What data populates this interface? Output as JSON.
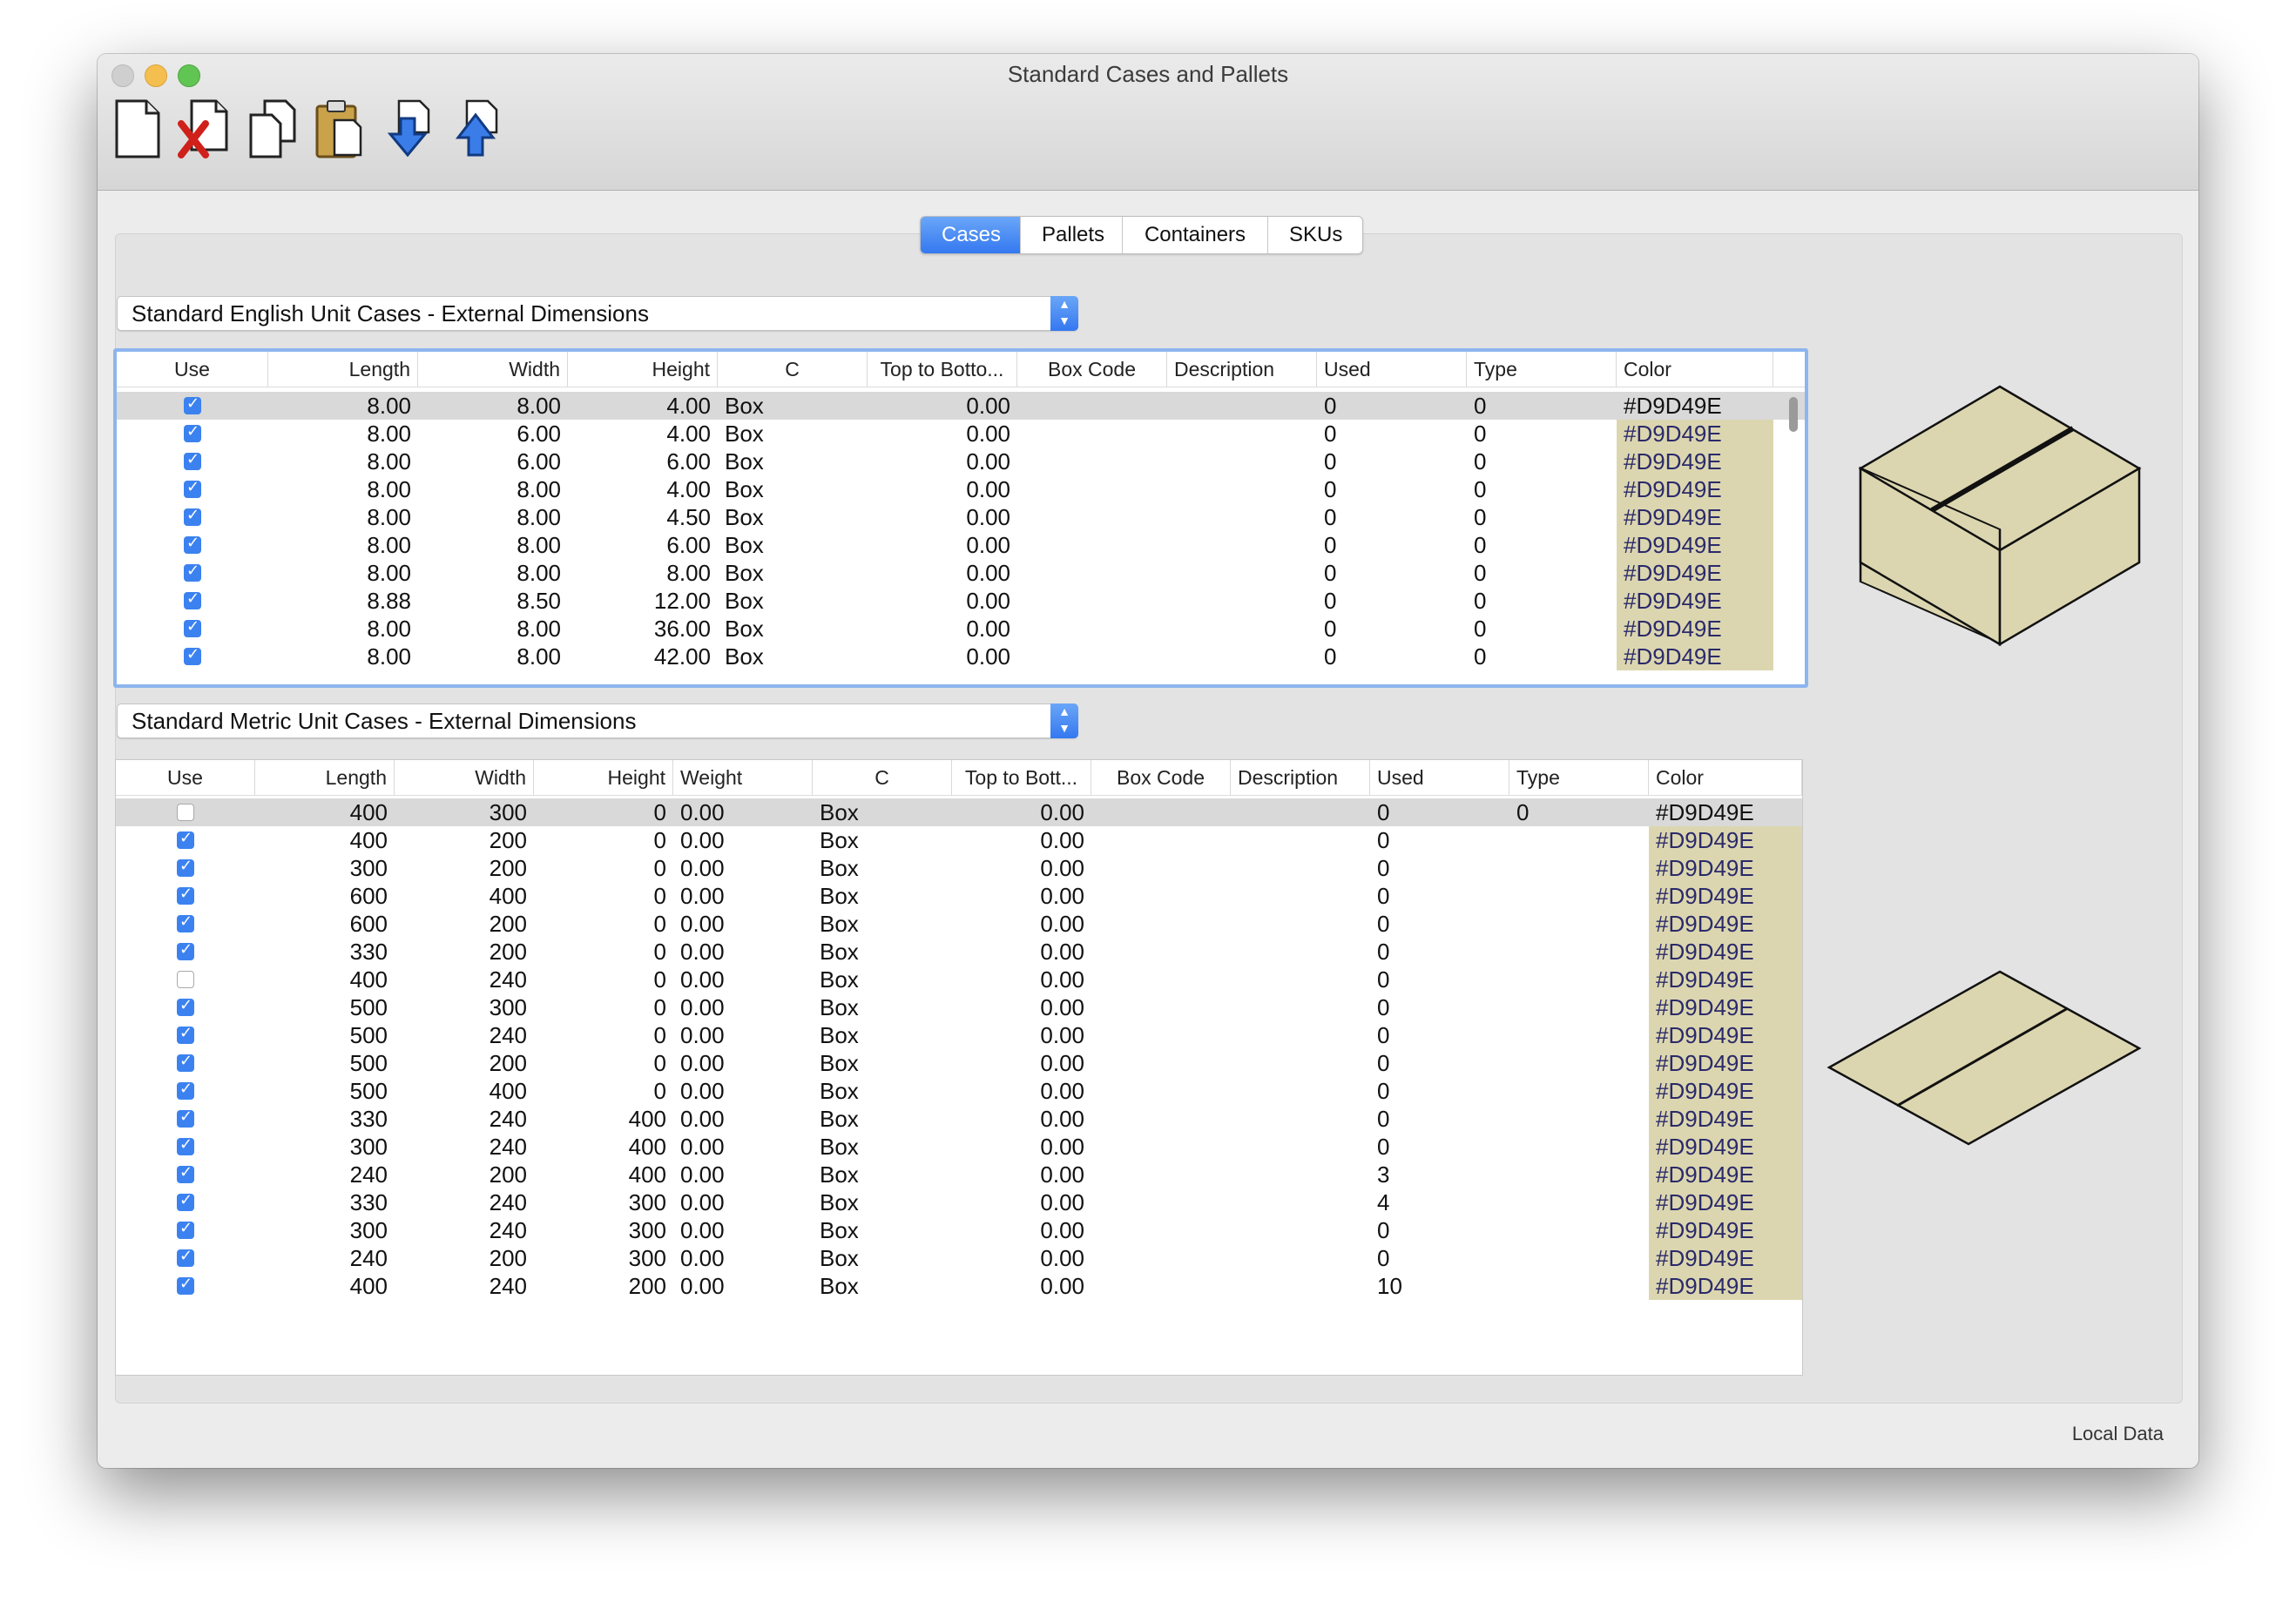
{
  "window": {
    "title": "Standard Cases and Pallets",
    "footer_label": "Local Data"
  },
  "toolbar": {
    "buttons": [
      {
        "name": "new-document",
        "icon": "new-document-icon"
      },
      {
        "name": "delete-document",
        "icon": "delete-document-icon"
      },
      {
        "name": "copy",
        "icon": "copy-icon"
      },
      {
        "name": "paste",
        "icon": "clipboard-icon"
      },
      {
        "name": "import",
        "icon": "download-arrow-icon"
      },
      {
        "name": "export",
        "icon": "upload-arrow-icon"
      }
    ]
  },
  "tabs": [
    "Cases",
    "Pallets",
    "Containers",
    "SKUs"
  ],
  "active_tab": "Cases",
  "english": {
    "select_value": "Standard English Unit Cases - External Dimensions",
    "headers": [
      "Use",
      "Length",
      "Width",
      "Height",
      "C",
      "Top to Botto...",
      "Box Code",
      "Description",
      "Used",
      "Type",
      "Color"
    ],
    "rows": [
      {
        "use": true,
        "length": "8.00",
        "width": "8.00",
        "height": "4.00",
        "c": "Box",
        "top": "0.00",
        "used": "0",
        "type": "0",
        "color": "#D9D49E"
      },
      {
        "use": true,
        "length": "8.00",
        "width": "6.00",
        "height": "4.00",
        "c": "Box",
        "top": "0.00",
        "used": "0",
        "type": "0",
        "color": "#D9D49E"
      },
      {
        "use": true,
        "length": "8.00",
        "width": "6.00",
        "height": "6.00",
        "c": "Box",
        "top": "0.00",
        "used": "0",
        "type": "0",
        "color": "#D9D49E"
      },
      {
        "use": true,
        "length": "8.00",
        "width": "8.00",
        "height": "4.00",
        "c": "Box",
        "top": "0.00",
        "used": "0",
        "type": "0",
        "color": "#D9D49E"
      },
      {
        "use": true,
        "length": "8.00",
        "width": "8.00",
        "height": "4.50",
        "c": "Box",
        "top": "0.00",
        "used": "0",
        "type": "0",
        "color": "#D9D49E"
      },
      {
        "use": true,
        "length": "8.00",
        "width": "8.00",
        "height": "6.00",
        "c": "Box",
        "top": "0.00",
        "used": "0",
        "type": "0",
        "color": "#D9D49E"
      },
      {
        "use": true,
        "length": "8.00",
        "width": "8.00",
        "height": "8.00",
        "c": "Box",
        "top": "0.00",
        "used": "0",
        "type": "0",
        "color": "#D9D49E"
      },
      {
        "use": true,
        "length": "8.88",
        "width": "8.50",
        "height": "12.00",
        "c": "Box",
        "top": "0.00",
        "used": "0",
        "type": "0",
        "color": "#D9D49E"
      },
      {
        "use": true,
        "length": "8.00",
        "width": "8.00",
        "height": "36.00",
        "c": "Box",
        "top": "0.00",
        "used": "0",
        "type": "0",
        "color": "#D9D49E"
      },
      {
        "use": true,
        "length": "8.00",
        "width": "8.00",
        "height": "42.00",
        "c": "Box",
        "top": "0.00",
        "used": "0",
        "type": "0",
        "color": "#D9D49E"
      }
    ]
  },
  "metric": {
    "select_value": "Standard Metric Unit Cases - External Dimensions",
    "headers": [
      "Use",
      "Length",
      "Width",
      "Height",
      "Weight",
      "C",
      "Top to Bott...",
      "Box Code",
      "Description",
      "Used",
      "Type",
      "Color"
    ],
    "rows": [
      {
        "use": false,
        "length": "400",
        "width": "300",
        "height": "0",
        "weight": "0.00",
        "c": "Box",
        "top": "0.00",
        "used": "0",
        "type": "0",
        "color": "#D9D49E"
      },
      {
        "use": true,
        "length": "400",
        "width": "200",
        "height": "0",
        "weight": "0.00",
        "c": "Box",
        "top": "0.00",
        "used": "0",
        "type": "",
        "color": "#D9D49E"
      },
      {
        "use": true,
        "length": "300",
        "width": "200",
        "height": "0",
        "weight": "0.00",
        "c": "Box",
        "top": "0.00",
        "used": "0",
        "type": "",
        "color": "#D9D49E"
      },
      {
        "use": true,
        "length": "600",
        "width": "400",
        "height": "0",
        "weight": "0.00",
        "c": "Box",
        "top": "0.00",
        "used": "0",
        "type": "",
        "color": "#D9D49E"
      },
      {
        "use": true,
        "length": "600",
        "width": "200",
        "height": "0",
        "weight": "0.00",
        "c": "Box",
        "top": "0.00",
        "used": "0",
        "type": "",
        "color": "#D9D49E"
      },
      {
        "use": true,
        "length": "330",
        "width": "200",
        "height": "0",
        "weight": "0.00",
        "c": "Box",
        "top": "0.00",
        "used": "0",
        "type": "",
        "color": "#D9D49E"
      },
      {
        "use": false,
        "length": "400",
        "width": "240",
        "height": "0",
        "weight": "0.00",
        "c": "Box",
        "top": "0.00",
        "used": "0",
        "type": "",
        "color": "#D9D49E"
      },
      {
        "use": true,
        "length": "500",
        "width": "300",
        "height": "0",
        "weight": "0.00",
        "c": "Box",
        "top": "0.00",
        "used": "0",
        "type": "",
        "color": "#D9D49E"
      },
      {
        "use": true,
        "length": "500",
        "width": "240",
        "height": "0",
        "weight": "0.00",
        "c": "Box",
        "top": "0.00",
        "used": "0",
        "type": "",
        "color": "#D9D49E"
      },
      {
        "use": true,
        "length": "500",
        "width": "200",
        "height": "0",
        "weight": "0.00",
        "c": "Box",
        "top": "0.00",
        "used": "0",
        "type": "",
        "color": "#D9D49E"
      },
      {
        "use": true,
        "length": "500",
        "width": "400",
        "height": "0",
        "weight": "0.00",
        "c": "Box",
        "top": "0.00",
        "used": "0",
        "type": "",
        "color": "#D9D49E"
      },
      {
        "use": true,
        "length": "330",
        "width": "240",
        "height": "400",
        "weight": "0.00",
        "c": "Box",
        "top": "0.00",
        "used": "0",
        "type": "",
        "color": "#D9D49E"
      },
      {
        "use": true,
        "length": "300",
        "width": "240",
        "height": "400",
        "weight": "0.00",
        "c": "Box",
        "top": "0.00",
        "used": "0",
        "type": "",
        "color": "#D9D49E"
      },
      {
        "use": true,
        "length": "240",
        "width": "200",
        "height": "400",
        "weight": "0.00",
        "c": "Box",
        "top": "0.00",
        "used": "3",
        "type": "",
        "color": "#D9D49E"
      },
      {
        "use": true,
        "length": "330",
        "width": "240",
        "height": "300",
        "weight": "0.00",
        "c": "Box",
        "top": "0.00",
        "used": "4",
        "type": "",
        "color": "#D9D49E"
      },
      {
        "use": true,
        "length": "300",
        "width": "240",
        "height": "300",
        "weight": "0.00",
        "c": "Box",
        "top": "0.00",
        "used": "0",
        "type": "",
        "color": "#D9D49E"
      },
      {
        "use": true,
        "length": "240",
        "width": "200",
        "height": "300",
        "weight": "0.00",
        "c": "Box",
        "top": "0.00",
        "used": "0",
        "type": "",
        "color": "#D9D49E"
      },
      {
        "use": true,
        "length": "400",
        "width": "240",
        "height": "200",
        "weight": "0.00",
        "c": "Box",
        "top": "0.00",
        "used": "10",
        "type": "",
        "color": "#D9D49E"
      }
    ]
  },
  "colors": {
    "accent": "#3478F0",
    "box_fill": "#DCD6B0",
    "selection": "#D9D9D9"
  }
}
